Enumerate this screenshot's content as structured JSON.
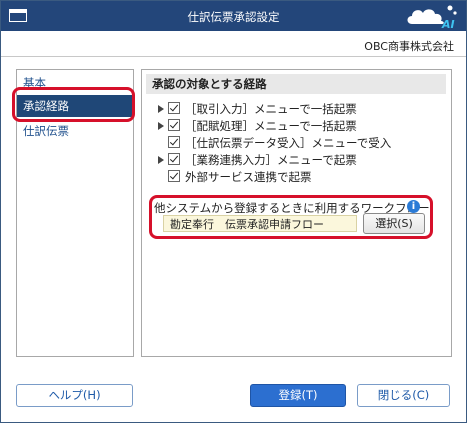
{
  "window": {
    "title": "仕訳伝票承認設定",
    "company": "OBC商事株式会社",
    "logo_text": "AI"
  },
  "sidebar": {
    "items": [
      {
        "label": "基本",
        "selected": false
      },
      {
        "label": "承認経路",
        "selected": true
      },
      {
        "label": "仕訳伝票",
        "selected": false
      }
    ]
  },
  "main": {
    "section_title": "承認の対象とする経路",
    "routes": [
      {
        "label": "［取引入力］メニューで一括起票",
        "expandable": true,
        "checked": true
      },
      {
        "label": "［配賦処理］メニューで一括起票",
        "expandable": true,
        "checked": true
      },
      {
        "label": "［仕訳伝票データ受入］メニューで受入",
        "expandable": false,
        "checked": true
      },
      {
        "label": "［業務連携入力］メニューで起票",
        "expandable": true,
        "checked": true
      },
      {
        "label": "外部サービス連携で起票",
        "expandable": false,
        "checked": true
      }
    ],
    "workflow": {
      "label": "他システムから登録するときに利用するワークフロー",
      "value": "勘定奉行　伝票承認申請フロー",
      "select_label": "選択(S)"
    }
  },
  "footer": {
    "help_label": "ヘルプ(H)",
    "register_label": "登録(T)",
    "close_label": "閉じる(C)"
  },
  "colors": {
    "titlebar": "#23467a",
    "selected_nav": "#1f4777",
    "highlight": "#d6102a",
    "primary_button": "#2c6fd0",
    "input_bg": "#fbf7dc",
    "info": "#2b7bd6"
  }
}
